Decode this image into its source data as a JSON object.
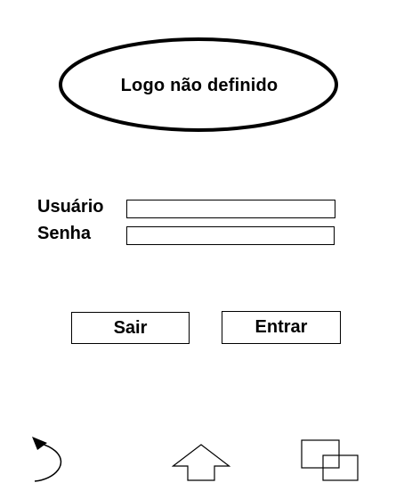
{
  "logo": {
    "text": "Logo não definido"
  },
  "login_form": {
    "user_label": "Usuário",
    "user_value": "",
    "password_label": "Senha",
    "password_value": ""
  },
  "actions": {
    "exit_label": "Sair",
    "enter_label": "Entrar"
  },
  "nav_bar": {
    "icons": [
      "back-arrow-icon",
      "home-arrow-icon",
      "recent-windows-icon"
    ]
  }
}
